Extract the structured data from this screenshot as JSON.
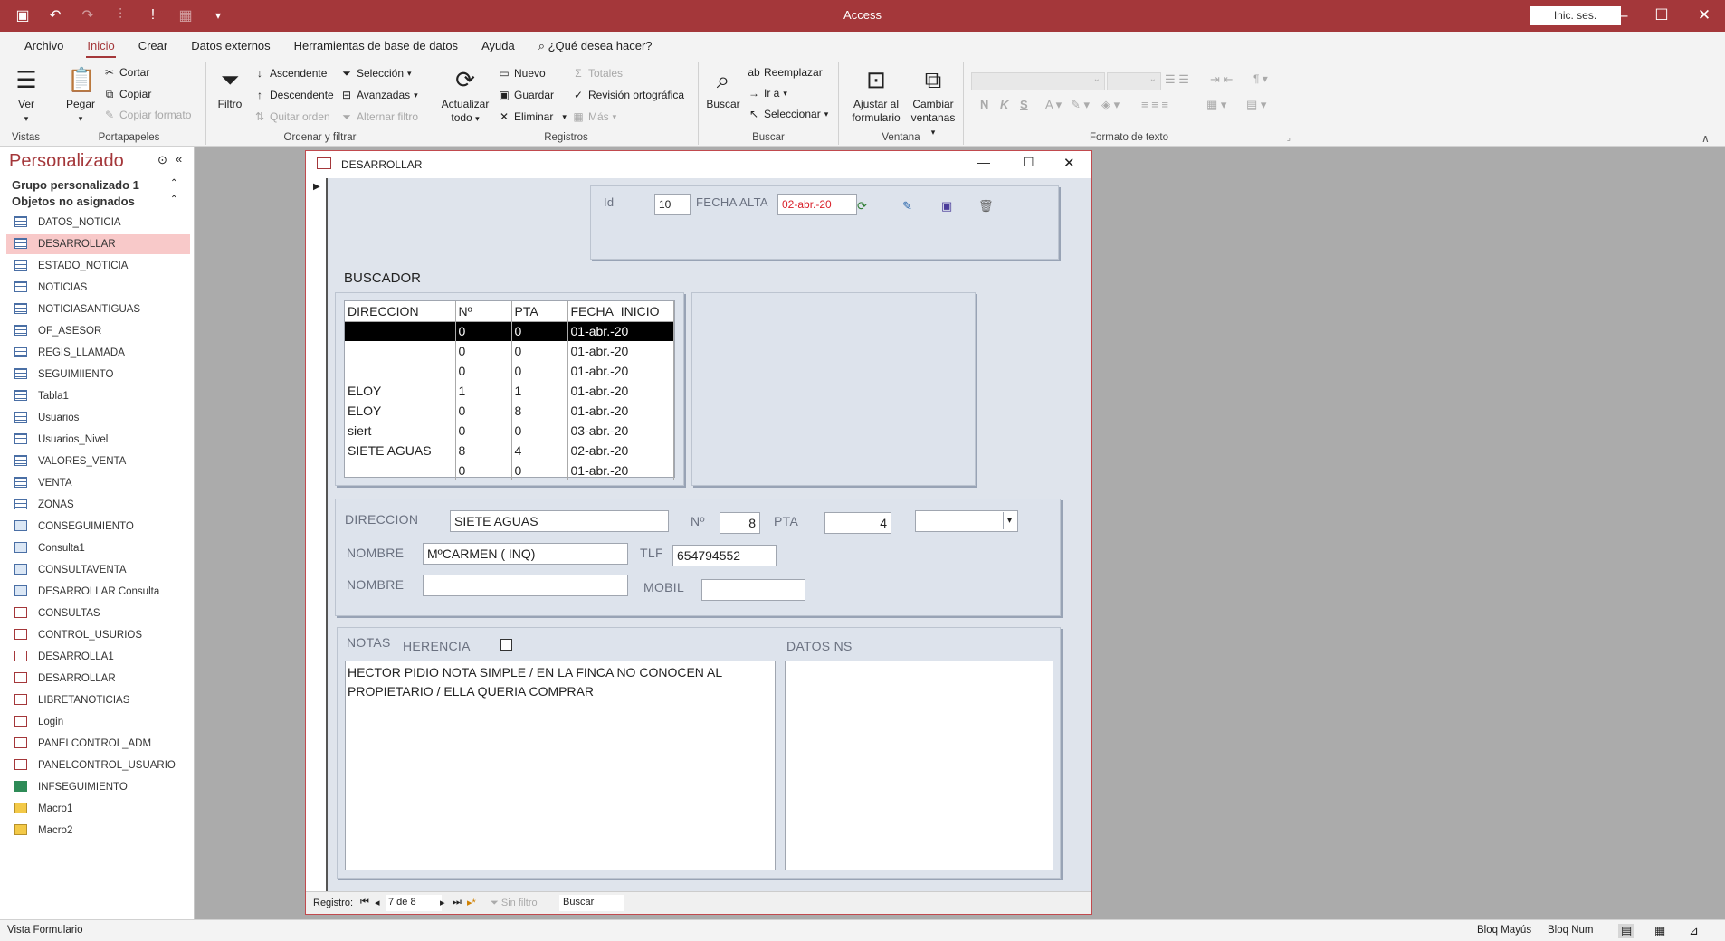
{
  "app": {
    "title": "Access",
    "signin": "Inic. ses."
  },
  "menu": [
    "Archivo",
    "Inicio",
    "Crear",
    "Datos externos",
    "Herramientas de base de datos",
    "Ayuda"
  ],
  "tell_me": "¿Qué desea hacer?",
  "ribbon": {
    "vistas": {
      "label": "Vistas",
      "ver": "Ver"
    },
    "portapapeles": {
      "label": "Portapapeles",
      "pegar": "Pegar",
      "cortar": "Cortar",
      "copiar": "Copiar",
      "copiar_formato": "Copiar formato"
    },
    "ordenar": {
      "label": "Ordenar y filtrar",
      "filtro": "Filtro",
      "ascendente": "Ascendente",
      "descendente": "Descendente",
      "quitar_orden": "Quitar orden",
      "seleccion": "Selección",
      "avanzadas": "Avanzadas",
      "alternar": "Alternar filtro"
    },
    "registros": {
      "label": "Registros",
      "actualizar1": "Actualizar",
      "actualizar2": "todo",
      "nuevo": "Nuevo",
      "guardar": "Guardar",
      "eliminar": "Eliminar",
      "totales": "Totales",
      "revision": "Revisión ortográfica",
      "mas": "Más"
    },
    "buscar": {
      "label": "Buscar",
      "buscar": "Buscar",
      "reemplazar": "Reemplazar",
      "ira": "Ir a",
      "seleccionar": "Seleccionar"
    },
    "ventana": {
      "label": "Ventana",
      "ajustar1": "Ajustar al",
      "ajustar2": "formulario",
      "cambiar1": "Cambiar",
      "cambiar2": "ventanas"
    },
    "formato": {
      "label": "Formato de texto",
      "bold": "N",
      "italic": "K",
      "underline": "S",
      "fontcolor": "A"
    }
  },
  "nav": {
    "title": "Personalizado",
    "group1": "Grupo personalizado 1",
    "group2": "Objetos no asignados",
    "items": [
      {
        "label": "DATOS_NOTICIA",
        "type": "tbl"
      },
      {
        "label": "DESARROLLAR",
        "type": "tbl",
        "selected": true
      },
      {
        "label": "ESTADO_NOTICIA",
        "type": "tbl"
      },
      {
        "label": "NOTICIAS",
        "type": "tbl"
      },
      {
        "label": "NOTICIASANTIGUAS",
        "type": "tbl"
      },
      {
        "label": "OF_ASESOR",
        "type": "tbl"
      },
      {
        "label": "REGIS_LLAMADA",
        "type": "tbl"
      },
      {
        "label": "SEGUIMIIENTO",
        "type": "tbl"
      },
      {
        "label": "Tabla1",
        "type": "tbl"
      },
      {
        "label": "Usuarios",
        "type": "tbl"
      },
      {
        "label": "Usuarios_Nivel",
        "type": "tbl"
      },
      {
        "label": "VALORES_VENTA",
        "type": "tbl"
      },
      {
        "label": "VENTA",
        "type": "tbl"
      },
      {
        "label": "ZONAS",
        "type": "tbl"
      },
      {
        "label": "CONSEGUIMIENTO",
        "type": "qry"
      },
      {
        "label": "Consulta1",
        "type": "qry"
      },
      {
        "label": "CONSULTAVENTA",
        "type": "qry"
      },
      {
        "label": "DESARROLLAR Consulta",
        "type": "qry"
      },
      {
        "label": "CONSULTAS",
        "type": "frm"
      },
      {
        "label": "CONTROL_USURIOS",
        "type": "frm"
      },
      {
        "label": "DESARROLLA1",
        "type": "frm"
      },
      {
        "label": "DESARROLLAR",
        "type": "frm"
      },
      {
        "label": "LIBRETANOTICIAS",
        "type": "frm"
      },
      {
        "label": "Login",
        "type": "frm"
      },
      {
        "label": "PANELCONTROL_ADM",
        "type": "frm"
      },
      {
        "label": "PANELCONTROL_USUARIO",
        "type": "frm"
      },
      {
        "label": "INFSEGUIMIENTO",
        "type": "rpt"
      },
      {
        "label": "Macro1",
        "type": "mac"
      },
      {
        "label": "Macro2",
        "type": "mac"
      }
    ]
  },
  "form": {
    "title": "DESARROLLAR",
    "header": {
      "id_label": "Id",
      "id_value": "10",
      "alta_label": "FECHA ALTA",
      "alta_value": "02-abr.-20"
    },
    "buscador_label": "BUSCADOR",
    "list": {
      "columns": [
        "DIRECCION",
        "Nº",
        "PTA",
        "FECHA_INICIO"
      ],
      "rows": [
        [
          "",
          "0",
          "0",
          "01-abr.-20"
        ],
        [
          "",
          "0",
          "0",
          "01-abr.-20"
        ],
        [
          "",
          "0",
          "0",
          "01-abr.-20"
        ],
        [
          "ELOY",
          "1",
          "1",
          "01-abr.-20"
        ],
        [
          "ELOY",
          "0",
          "8",
          "01-abr.-20"
        ],
        [
          "siert",
          "0",
          "0",
          "03-abr.-20"
        ],
        [
          "SIETE AGUAS",
          "8",
          "4",
          "02-abr.-20"
        ],
        [
          "",
          "0",
          "0",
          "01-abr.-20"
        ]
      ]
    },
    "detail": {
      "direccion_label": "DIRECCION",
      "direccion_value": "SIETE AGUAS",
      "n_label": "Nº",
      "n_value": "8",
      "pta_label": "PTA",
      "pta_value": "4",
      "nombre_label": "NOMBRE",
      "nombre_value": "MºCARMEN ( INQ)",
      "tlf_label": "TLF",
      "tlf_value": "654794552",
      "nombre2_label": "NOMBRE",
      "nombre2_value": "",
      "mobil_label": "MOBIL",
      "mobil_value": ""
    },
    "notas": {
      "label": "NOTAS",
      "herencia_label": "HERENCIA",
      "text": "HECTOR PIDIO NOTA SIMPLE / EN LA FINCA NO CONOCEN AL PROPIETARIO / ELLA QUERIA COMPRAR",
      "datos_label": "DATOS NS"
    },
    "recbar": {
      "label": "Registro:",
      "value": "7 de 8",
      "filter": "Sin filtro",
      "search": "Buscar"
    }
  },
  "status": {
    "left": "Vista Formulario",
    "caps": "Bloq Mayús",
    "num": "Bloq Num"
  }
}
